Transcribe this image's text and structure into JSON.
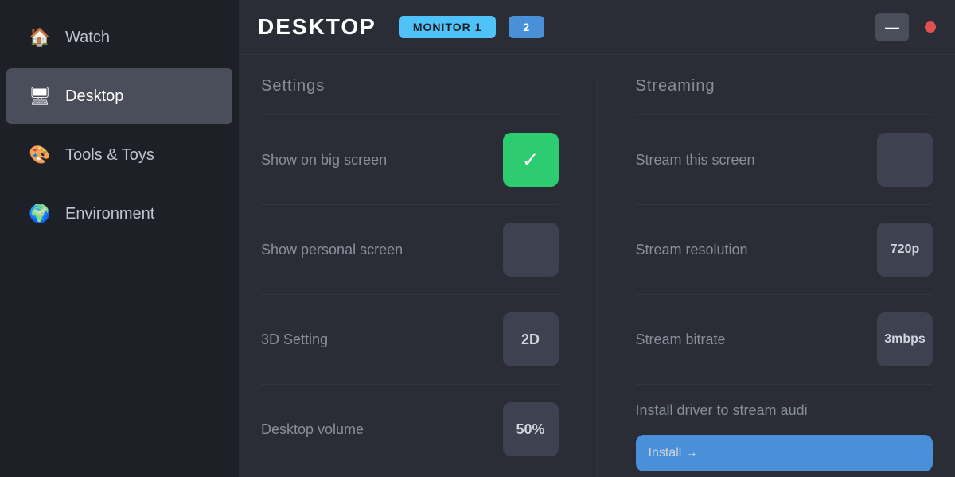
{
  "sidebar": {
    "items": [
      {
        "label": "Watch",
        "icon": "🏠",
        "active": false,
        "name": "watch"
      },
      {
        "label": "Desktop",
        "icon": "🖥",
        "active": true,
        "name": "desktop"
      },
      {
        "label": "Tools & Toys",
        "icon": "🎨",
        "active": false,
        "name": "tools"
      },
      {
        "label": "Environment",
        "icon": "🌍",
        "active": false,
        "name": "environment"
      }
    ]
  },
  "header": {
    "title": "DESKTOP",
    "monitor1_label": "MONITOR 1",
    "monitor2_label": "2",
    "minimize_label": "—"
  },
  "settings": {
    "title": "Settings",
    "rows": [
      {
        "label": "Show on big screen",
        "type": "checkbox",
        "checked": true,
        "value": "✓",
        "name": "show-big-screen"
      },
      {
        "label": "Show personal screen",
        "type": "checkbox",
        "checked": false,
        "value": "",
        "name": "show-personal-screen"
      },
      {
        "label": "3D Setting",
        "type": "value",
        "value": "2D",
        "name": "3d-setting"
      },
      {
        "label": "Desktop volume",
        "type": "value",
        "value": "50%",
        "name": "desktop-volume"
      }
    ]
  },
  "streaming": {
    "title": "Streaming",
    "rows": [
      {
        "label": "Stream this screen",
        "type": "checkbox",
        "checked": false,
        "value": "",
        "name": "stream-this-screen"
      },
      {
        "label": "Stream resolution",
        "type": "value",
        "value": "720p",
        "name": "stream-resolution"
      },
      {
        "label": "Stream bitrate",
        "type": "value",
        "value": "3mbps",
        "name": "stream-bitrate"
      }
    ],
    "install_label": "Install driver to stream audi",
    "install_btn_label": "Install →"
  }
}
